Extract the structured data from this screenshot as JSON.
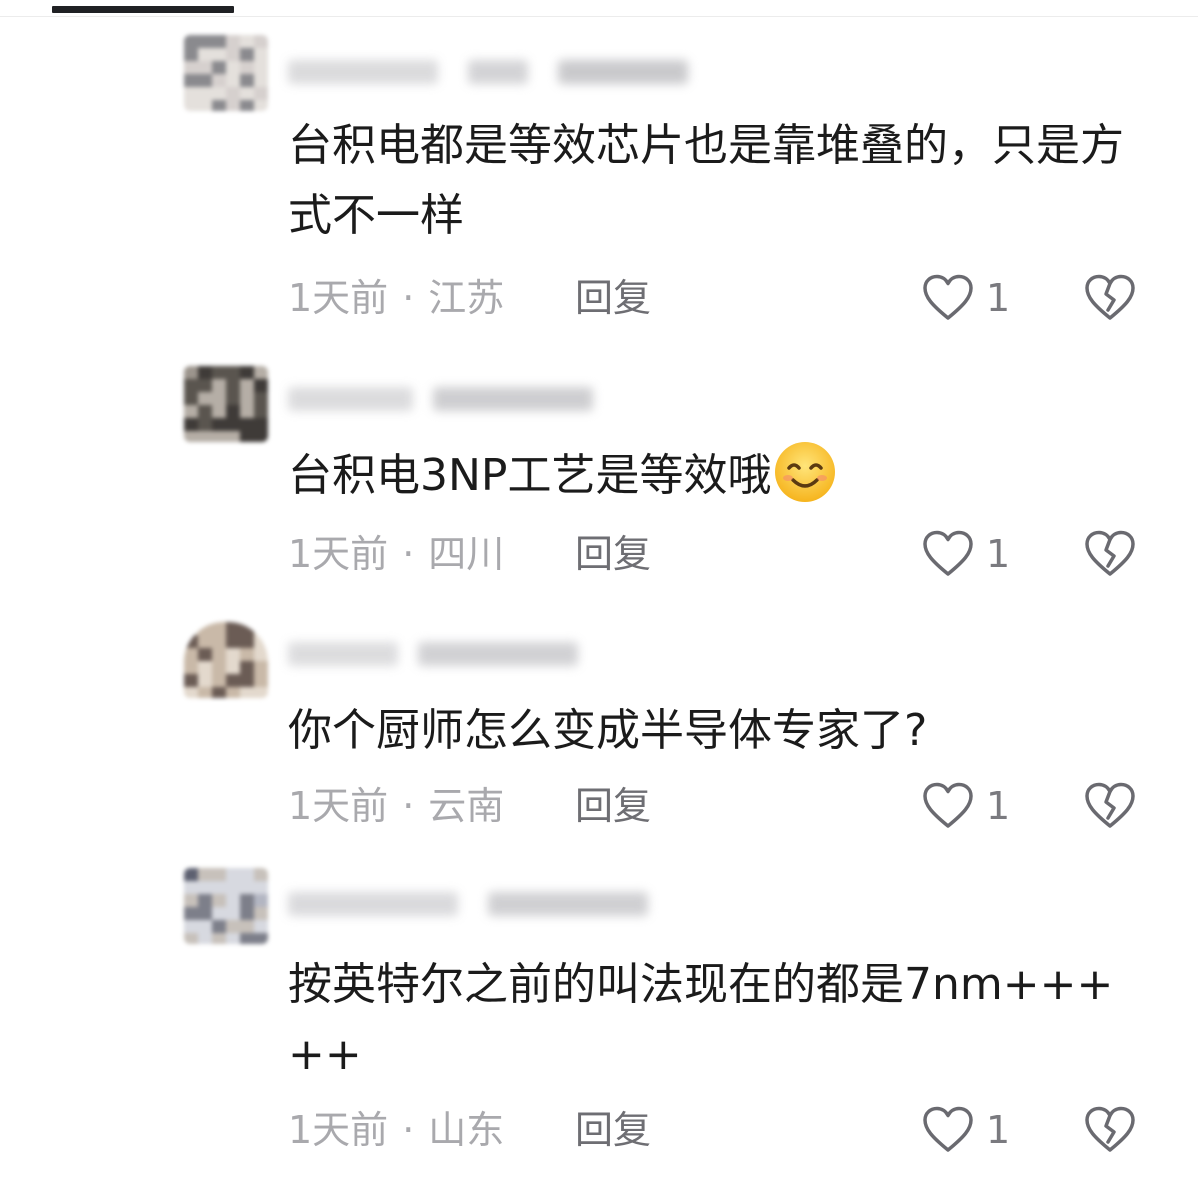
{
  "comments": [
    {
      "text": "台积电都是等效芯片也是靠堆叠的，只是方式不一样",
      "time": "1天前",
      "separator": "·",
      "region": "江苏",
      "reply_label": "回复",
      "likes": "1",
      "avatar_colors": [
        "#8a8a8e",
        "#bdb7b5",
        "#d6d0ce",
        "#5f5a5c",
        "#e4e0dc",
        "#c8c0b2"
      ]
    },
    {
      "text": "台积电3NP工艺是等效哦",
      "emoji": "smiling-face-emoji",
      "time": "1天前",
      "separator": "·",
      "region": "四川",
      "reply_label": "回复",
      "likes": "1",
      "avatar_colors": [
        "#3f3b38",
        "#7a756f",
        "#b5aea6",
        "#d9d3cb",
        "#5a554f",
        "#9c958d"
      ]
    },
    {
      "text": "你个厨师怎么变成半导体专家了?",
      "time": "1天前",
      "separator": "·",
      "region": "云南",
      "reply_label": "回复",
      "likes": "1",
      "avatar_colors": [
        "#6b5c55",
        "#a79585",
        "#c9b9a8",
        "#8d7b72",
        "#e3d9cd",
        "#b06f5e"
      ]
    },
    {
      "text": "按英特尔之前的叫法现在的都是7nm+++++",
      "time": "1天前",
      "separator": "·",
      "region": "山东",
      "reply_label": "回复",
      "likes": "1",
      "avatar_colors": [
        "#7d7f8a",
        "#b3b6c2",
        "#d7d9e0",
        "#5d6070",
        "#c7c1bb",
        "#9ea3b4"
      ]
    }
  ],
  "colors": {
    "text_primary": "#1b1b1b",
    "text_meta": "#a9a9ad",
    "reply": "#6e6e73",
    "icon_stroke": "#6a6a70"
  },
  "icons": {
    "like": "heart-outline-icon",
    "dislike": "broken-heart-icon"
  }
}
